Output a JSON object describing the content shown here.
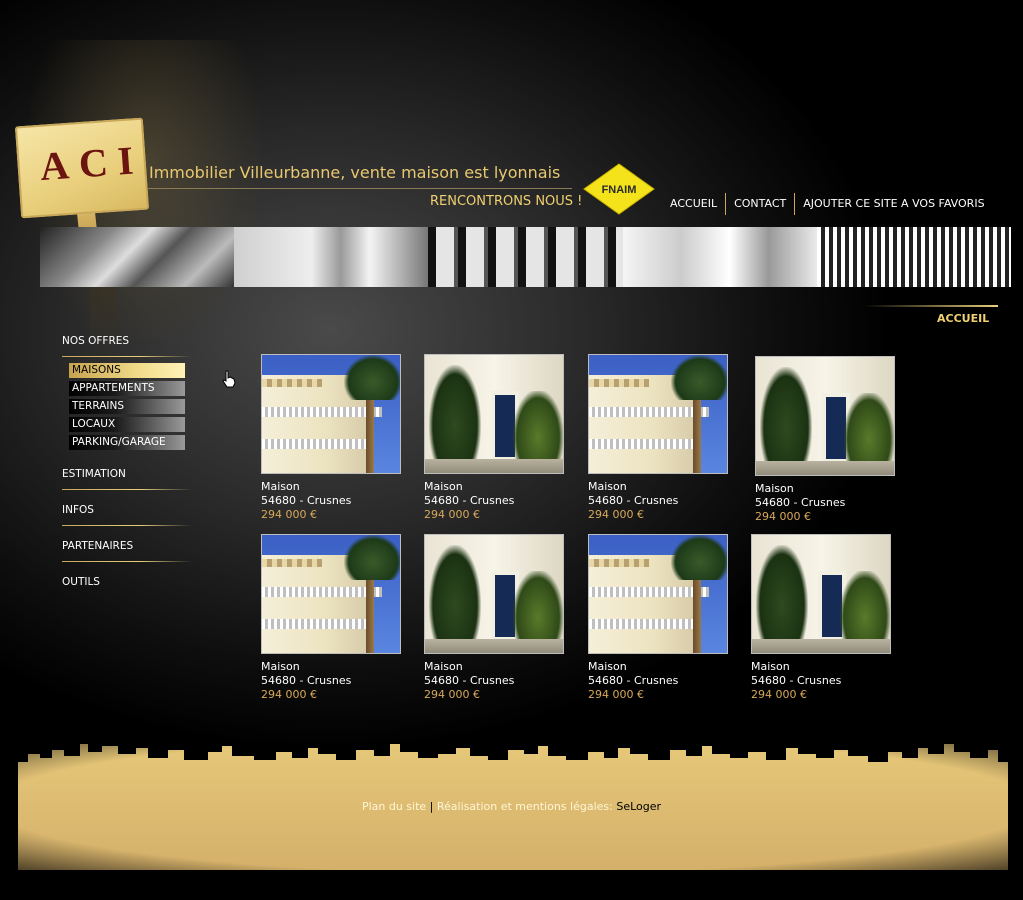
{
  "header": {
    "logo_text": "ACI",
    "tagline": "Immobilier Villeurbanne, vente maison est lyonnais",
    "slogan": "RENCONTRONS NOUS !",
    "fnaim_label": "FNAIM"
  },
  "topnav": {
    "items": [
      "ACCUEIL",
      "CONTACT",
      "AJOUTER CE SITE A VOS  FAVORIS"
    ]
  },
  "page_title": "ACCUEIL",
  "sidebar": {
    "section_title": "NOS OFFRES",
    "offers": [
      "MAISONS",
      "APPARTEMENTS",
      "TERRAINS",
      "LOCAUX",
      "PARKING/GARAGE"
    ],
    "active_offer": "MAISONS",
    "sections": [
      "ESTIMATION",
      "INFOS",
      "PARTENAIRES",
      "OUTILS"
    ]
  },
  "listings": [
    {
      "type": "Maison",
      "location": "54680 - Crusnes",
      "price": "294 000 €",
      "image": "palm-building"
    },
    {
      "type": "Maison",
      "location": "54680 - Crusnes",
      "price": "294 000 €",
      "image": "door-shrubs"
    },
    {
      "type": "Maison",
      "location": "54680 - Crusnes",
      "price": "294 000 €",
      "image": "palm-building"
    },
    {
      "type": "Maison",
      "location": "54680 - Crusnes",
      "price": "294 000 €",
      "image": "door-shrubs"
    },
    {
      "type": "Maison",
      "location": "54680 - Crusnes",
      "price": "294 000 €",
      "image": "palm-building"
    },
    {
      "type": "Maison",
      "location": "54680 - Crusnes",
      "price": "294 000 €",
      "image": "door-shrubs"
    },
    {
      "type": "Maison",
      "location": "54680 - Crusnes",
      "price": "294 000 €",
      "image": "palm-building"
    },
    {
      "type": "Maison",
      "location": "54680 - Crusnes",
      "price": "294 000 €",
      "image": "door-shrubs"
    }
  ],
  "footer": {
    "plan": "Plan du site",
    "separator": "|",
    "mentions": "Réalisation et mentions légales:",
    "seloger": "SeLoger"
  },
  "colors": {
    "accent_gold": "#e9cf7c",
    "price": "#d8a85a",
    "background": "#000000"
  },
  "icons": [
    "hand-cursor-icon",
    "fnaim-logo-icon"
  ]
}
